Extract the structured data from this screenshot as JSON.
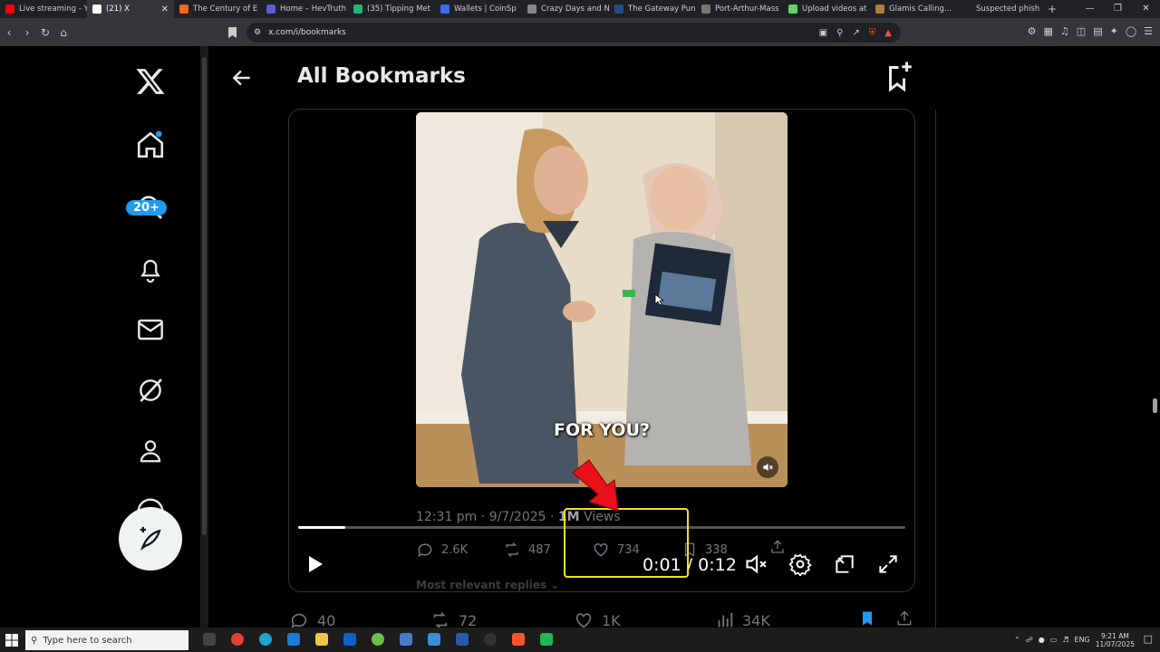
{
  "browser": {
    "tabs": [
      {
        "label": "Live streaming - Y",
        "color": "#ff0000"
      },
      {
        "label": "(21) X",
        "color": "#ffffff",
        "active": true
      },
      {
        "label": "The Century of E",
        "color": "#f26522"
      },
      {
        "label": "Home – HevTruth",
        "color": "#5b5bd6"
      },
      {
        "label": "(35) Tipping Met",
        "color": "#22b573"
      },
      {
        "label": "Wallets | CoinSp",
        "color": "#3a6df0"
      },
      {
        "label": "Crazy Days and N",
        "color": "#888888"
      },
      {
        "label": "The Gateway Pun",
        "color": "#1f4e8c"
      },
      {
        "label": "Port-Arthur-Mass",
        "color": "#777777"
      },
      {
        "label": "Upload videos at",
        "color": "#5ed46b"
      },
      {
        "label": "Glamis Calling...",
        "color": "#b07a3c"
      },
      {
        "label": "Suspected phish",
        "color": "#222222"
      }
    ],
    "url": "x.com/i/bookmarks"
  },
  "sidebar": {
    "notification_badge": "20+"
  },
  "header": {
    "title": "All Bookmarks"
  },
  "video": {
    "subtitle": "FOR YOU?",
    "progress_fraction": 0.078,
    "current_time": "0:01",
    "separator": " / ",
    "duration": "0:12"
  },
  "tweet": {
    "time": "12:31 pm",
    "date": "9/7/2025",
    "views_count": "1M",
    "views_label": "Views",
    "replies": "2.6K",
    "reposts": "487",
    "likes": "734",
    "bookmarks": "338",
    "replies_sort_label": "Most relevant replies"
  },
  "next_post": {
    "replies": "40",
    "reposts": "72",
    "likes": "1K",
    "views": "34K"
  },
  "taskbar": {
    "search_placeholder": "Type here to search",
    "lang": "ENG",
    "clock_time": "9:21 AM",
    "clock_date": "11/07/2025"
  }
}
